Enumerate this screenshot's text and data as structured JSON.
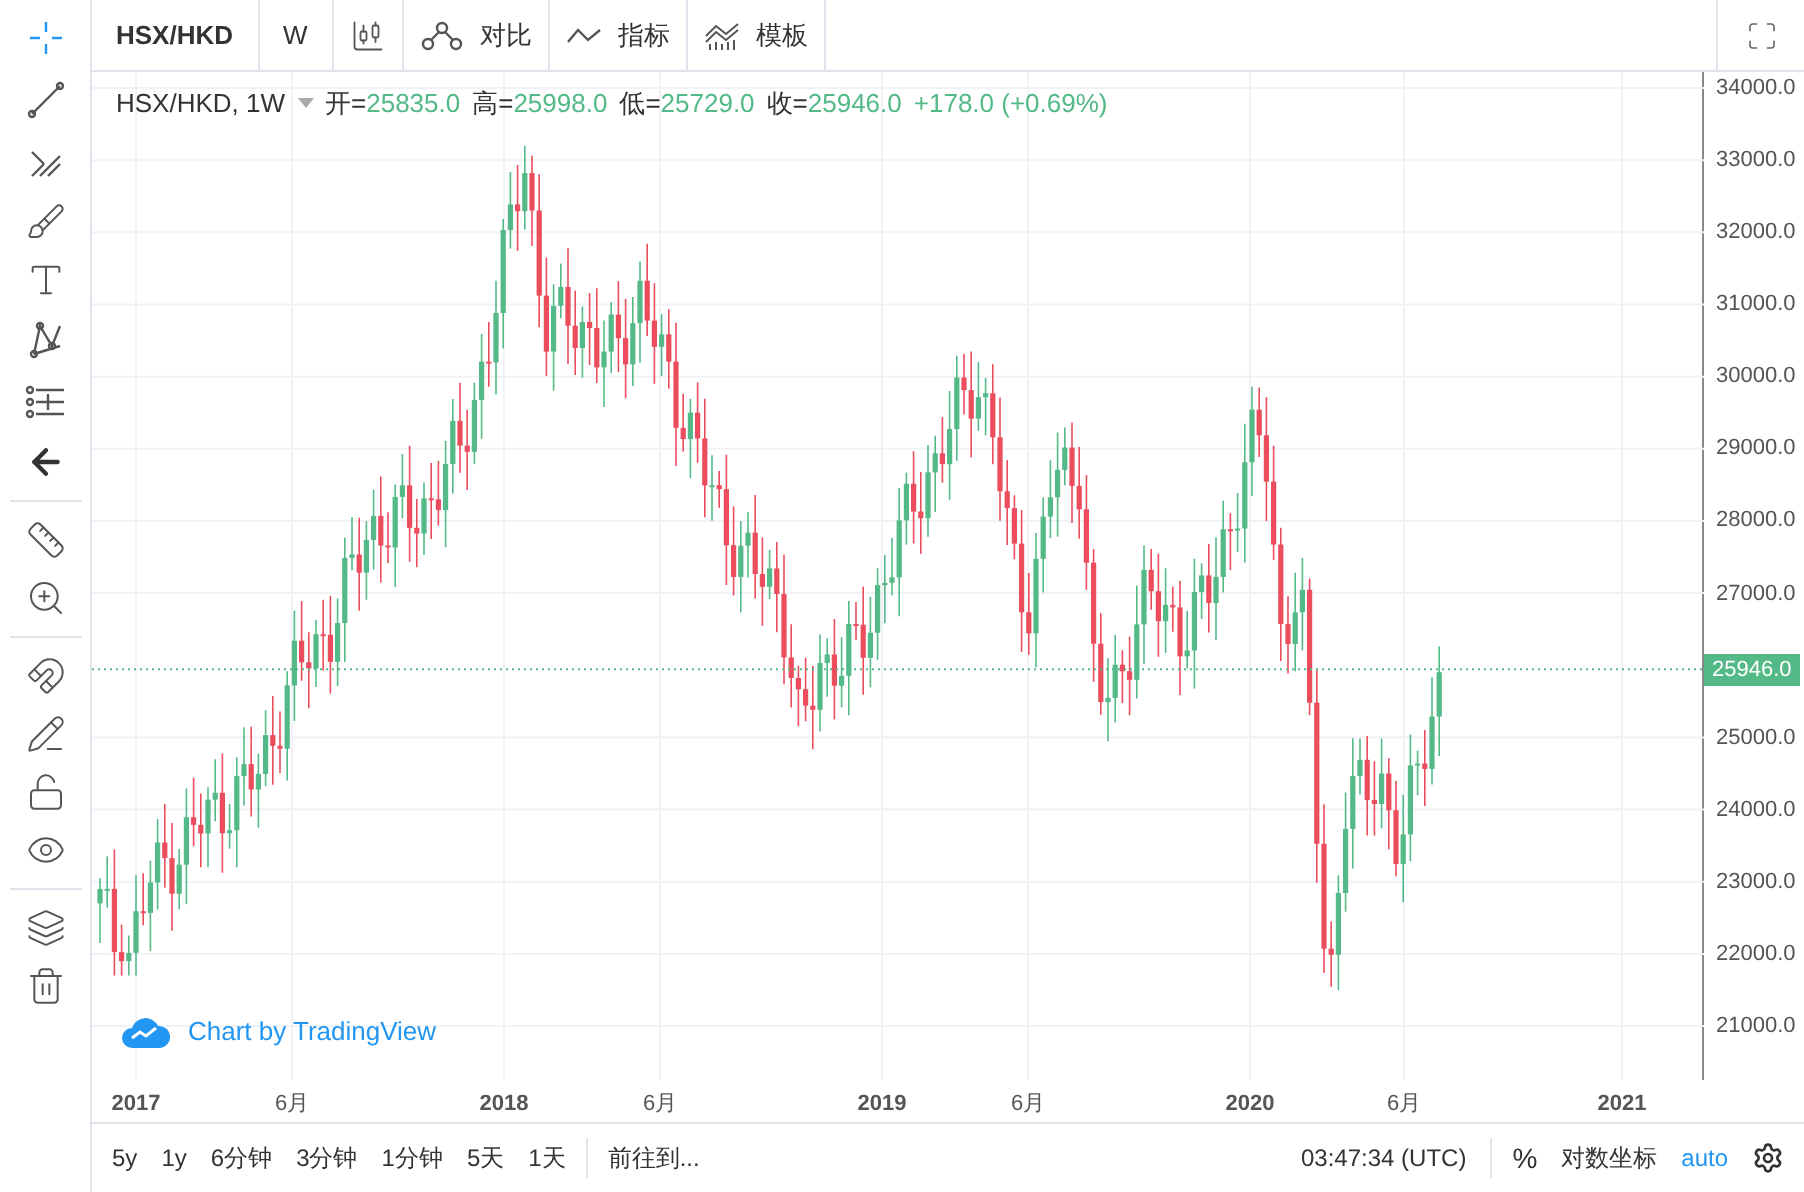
{
  "toolbar": {
    "symbol": "HSX/HKD",
    "interval": "W",
    "buttons": [
      {
        "kind": "compare",
        "label": "对比"
      },
      {
        "kind": "indicators",
        "label": "指标"
      },
      {
        "kind": "templates",
        "label": "模板"
      }
    ]
  },
  "legend": {
    "title": "HSX/HKD, 1W",
    "values": [
      {
        "label": "开=",
        "value": "25835.0"
      },
      {
        "label": "高=",
        "value": "25998.0"
      },
      {
        "label": "低=",
        "value": "25729.0"
      },
      {
        "label": "收=",
        "value": "25946.0"
      }
    ],
    "change": "+178.0 (+0.69%)"
  },
  "price_axis": {
    "ticks": [
      "34000.0",
      "33000.0",
      "32000.0",
      "31000.0",
      "30000.0",
      "29000.0",
      "28000.0",
      "27000.0",
      "25000.0",
      "24000.0",
      "23000.0",
      "22000.0",
      "21000.0"
    ],
    "last_price": "25946.0"
  },
  "time_axis": [
    {
      "kind": "year",
      "label": "2017"
    },
    {
      "kind": "month",
      "label": "6月"
    },
    {
      "kind": "year",
      "label": "2018"
    },
    {
      "kind": "month",
      "label": "6月"
    },
    {
      "kind": "year",
      "label": "2019"
    },
    {
      "kind": "month",
      "label": "6月"
    },
    {
      "kind": "year",
      "label": "2020"
    },
    {
      "kind": "month",
      "label": "6月"
    },
    {
      "kind": "year",
      "label": "2021"
    }
  ],
  "branding": "Chart by TradingView",
  "ranges": [
    "5y",
    "1y",
    "6分钟",
    "3分钟",
    "1分钟",
    "5天",
    "1天"
  ],
  "goto": "前往到...",
  "clock": "03:47:34 (UTC)",
  "percent": "%",
  "log_scale": "对数坐标",
  "auto": "auto"
}
